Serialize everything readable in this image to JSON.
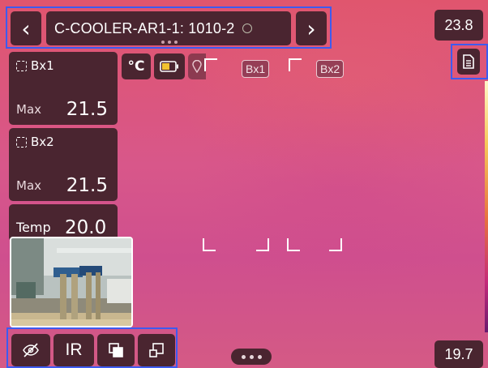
{
  "header": {
    "title": "C-COOLER-AR1-1: 1010-2",
    "prev_icon": "chevron-left-icon",
    "next_icon": "chevron-right-icon"
  },
  "scale": {
    "max": "23.8",
    "min": "19.7"
  },
  "measurements": [
    {
      "label": "Bx1",
      "stat": "Max",
      "value": "21.5"
    },
    {
      "label": "Bx2",
      "stat": "Max",
      "value": "21.5"
    }
  ],
  "spot": {
    "label": "Temp",
    "value": "20.0"
  },
  "status": {
    "unit": "°C",
    "battery_icon": "battery-icon",
    "gps_icon": "gps-icon"
  },
  "markers": {
    "box1": "Bx1",
    "box2": "Bx2"
  },
  "toolbar": {
    "hide_icon": "eye-off-icon",
    "ir_label": "IR",
    "overlay_icon": "overlay-icon",
    "pip_icon": "picture-in-picture-icon",
    "more_icon": "more-dots-icon",
    "report_icon": "report-icon"
  },
  "colors": {
    "highlight": "#3d5bf0",
    "panel": "#4a2530",
    "thermal_bg": "#d8578a",
    "battery": "#f2c230"
  }
}
